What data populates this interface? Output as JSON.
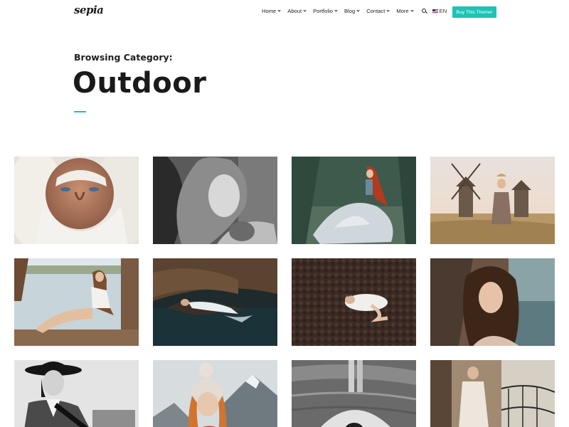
{
  "header": {
    "logo": "sepia",
    "nav": [
      {
        "label": "Home",
        "has_dropdown": true
      },
      {
        "label": "About",
        "has_dropdown": true
      },
      {
        "label": "Portfolio",
        "has_dropdown": true
      },
      {
        "label": "Blog",
        "has_dropdown": true
      },
      {
        "label": "Contact",
        "has_dropdown": true
      },
      {
        "label": "More",
        "has_dropdown": true
      }
    ],
    "search_icon": "search-icon",
    "language": "EN",
    "language_flag": "us-flag-icon",
    "buy_button": "Buy This Theme!"
  },
  "page": {
    "browsing_label": "Browsing Category:",
    "category_title": "Outdoor"
  },
  "colors": {
    "accent": "#1cc3b6",
    "text": "#1e1e1e"
  },
  "gallery": {
    "items": [
      {
        "subject": "old-man-white-beard"
      },
      {
        "subject": "woman-curly-hair-bw"
      },
      {
        "subject": "redhead-white-gown-forest"
      },
      {
        "subject": "woman-dress-windmills-field"
      },
      {
        "subject": "woman-sitting-lakeside-dock"
      },
      {
        "subject": "woman-lying-in-water"
      },
      {
        "subject": "woman-curled-on-leaves"
      },
      {
        "subject": "woman-portrait-lake"
      },
      {
        "subject": "woman-black-hat-bw"
      },
      {
        "subject": "woman-knit-hat-mountains"
      },
      {
        "subject": "woman-floating-water-bw"
      },
      {
        "subject": "woman-lace-dress-balcony"
      }
    ]
  }
}
